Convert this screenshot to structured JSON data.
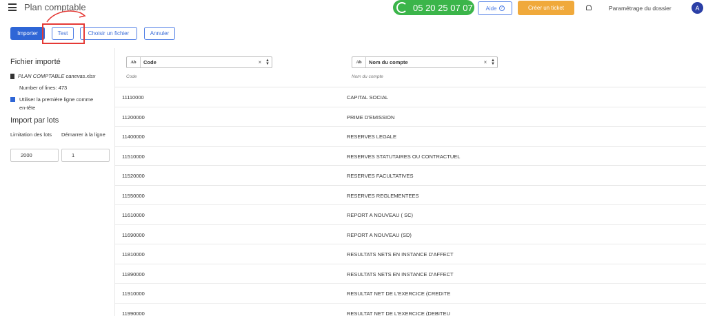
{
  "header": {
    "title": "Plan comptable",
    "phone": "05 20 25 07 07",
    "help_label": "Aide",
    "ticket_label": "Créer un ticket",
    "settings_label": "Paramétrage du dossier",
    "avatar_initial": "A",
    "colors": {
      "phone_bg": "#3bb54a",
      "ticket_bg": "#f0a93b",
      "accent": "#2f66d6"
    }
  },
  "toolbar": {
    "import_label": "Importer",
    "test_label": "Test",
    "choose_label": "Choisir un fichier",
    "cancel_label": "Annuler"
  },
  "sidebar": {
    "imported_title": "Fichier importé",
    "file_name": "PLAN COMPTABLE canevas.xlsx",
    "lines_count": "Number of lines: 473",
    "use_first_row_label": "Utiliser la première ligne comme en-tête",
    "use_first_row_checked": true,
    "batch_title": "Import par lots",
    "limit_label": "Limitation des lots",
    "start_label": "Démarrer à la ligne",
    "limit_value": "2000",
    "start_value": "1"
  },
  "table": {
    "columns": [
      {
        "type_icon": "Ab",
        "filter": "Code",
        "hint": "Code"
      },
      {
        "type_icon": "Ab",
        "filter": "Nom du compte",
        "hint": "Nom du compte"
      }
    ],
    "rows": [
      {
        "code": "11110000",
        "name": "CAPITAL SOCIAL"
      },
      {
        "code": "11200000",
        "name": "PRIME D'EMISSION"
      },
      {
        "code": "11400000",
        "name": "RESERVES LEGALE"
      },
      {
        "code": "11510000",
        "name": "RESERVES STATUTAIRES OU CONTRACTUEL"
      },
      {
        "code": "11520000",
        "name": "RESERVES FACULTATIVES"
      },
      {
        "code": "11550000",
        "name": "RESERVES REGLEMENTEES"
      },
      {
        "code": "11610000",
        "name": "REPORT A NOUVEAU ( SC)"
      },
      {
        "code": "11690000",
        "name": "REPORT A NOUVEAU (SD)"
      },
      {
        "code": "11810000",
        "name": "RESULTATS NETS EN INSTANCE D'AFFECT"
      },
      {
        "code": "11890000",
        "name": "RESULTATS NETS EN INSTANCE D'AFFECT"
      },
      {
        "code": "11910000",
        "name": "RESULTAT NET DE L'EXERCICE (CREDITE"
      },
      {
        "code": "11990000",
        "name": "RESULTAT NET DE L'EXERCICE (DEBITEU"
      }
    ]
  }
}
